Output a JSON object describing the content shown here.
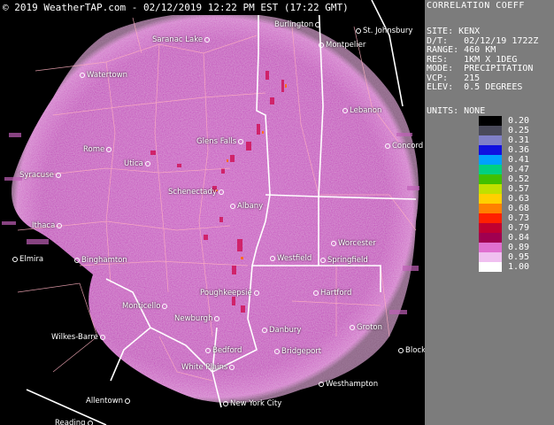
{
  "banner": "© 2019 WeatherTAP.com - 02/12/2019 12:22 PM EST (17:22 GMT)",
  "panel": {
    "title": "CORRELATION COEFF",
    "info": [
      "SITE: KENX",
      "",
      "D/T:   02/12/19 1722Z",
      "RANGE: 460 KM",
      "RES:   1KM X 1DEG",
      "MODE:  PRECIPITATION",
      "VCP:   215",
      "ELEV:  0.5 DEGREES"
    ],
    "units": "UNITS: NONE"
  },
  "legend": {
    "values": [
      "0.20",
      "0.25",
      "0.31",
      "0.36",
      "0.41",
      "0.47",
      "0.52",
      "0.57",
      "0.63",
      "0.68",
      "0.73",
      "0.79",
      "0.84",
      "0.89",
      "0.95",
      "1.00"
    ],
    "colors": [
      "#000000",
      "#4a4a5a",
      "#8080c8",
      "#1010e0",
      "#00a0ff",
      "#00d080",
      "#40c000",
      "#c0e000",
      "#ffd000",
      "#ff8000",
      "#ff2000",
      "#c00030",
      "#a00050",
      "#e070d0",
      "#f0c0f0",
      "#ffffff"
    ]
  },
  "map": {
    "echo_color": "#c040b8",
    "cities": [
      {
        "name": "Saranac Lake"
      },
      {
        "name": "Burlington"
      },
      {
        "name": "St. Johnsbury"
      },
      {
        "name": "Montpelier"
      },
      {
        "name": "Watertown"
      },
      {
        "name": "Lebanon"
      },
      {
        "name": "Glens Falls"
      },
      {
        "name": "Rome"
      },
      {
        "name": "Utica"
      },
      {
        "name": "Concord"
      },
      {
        "name": "Syracuse"
      },
      {
        "name": "Schenectady"
      },
      {
        "name": "Albany"
      },
      {
        "name": "Ithaca"
      },
      {
        "name": "Worcester"
      },
      {
        "name": "Elmira"
      },
      {
        "name": "Binghamton"
      },
      {
        "name": "Westfield"
      },
      {
        "name": "Springfield"
      },
      {
        "name": "Poughkeepsie"
      },
      {
        "name": "Hartford"
      },
      {
        "name": "Monticello"
      },
      {
        "name": "Newburgh"
      },
      {
        "name": "Wilkes-Barre"
      },
      {
        "name": "Danbury"
      },
      {
        "name": "Groton"
      },
      {
        "name": "Bedford"
      },
      {
        "name": "Bridgeport"
      },
      {
        "name": "Block I."
      },
      {
        "name": "White Plains"
      },
      {
        "name": "Westhampton"
      },
      {
        "name": "Allentown"
      },
      {
        "name": "New York City"
      },
      {
        "name": "Reading"
      }
    ]
  }
}
